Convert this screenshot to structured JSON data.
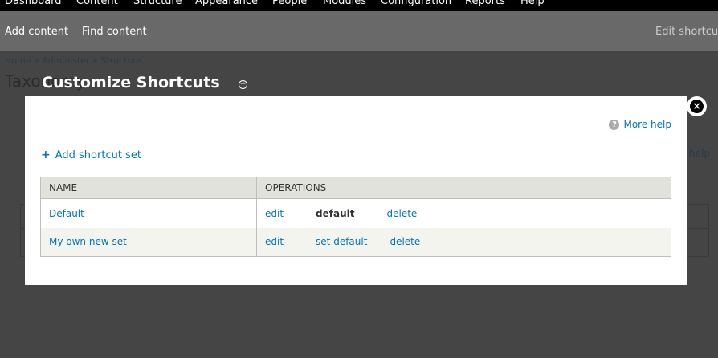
{
  "toolbar": {
    "items": [
      "Dashboard",
      "Content",
      "Structure",
      "Appearance",
      "People",
      "Modules",
      "Configuration",
      "Reports",
      "Help"
    ]
  },
  "shortcuts": {
    "items": [
      "Add content",
      "Find content"
    ],
    "edit": "Edit shortcuts"
  },
  "background": {
    "breadcrumb": "Home » Administer » Structure",
    "title": "Taxonomy",
    "help": "help"
  },
  "dialog": {
    "title": "Customize Shortcuts",
    "more_help": "More help",
    "add_set": "Add shortcut set",
    "columns": [
      "NAME",
      "OPERATIONS"
    ],
    "rows": [
      {
        "name": "Default",
        "edit": "edit",
        "status": "default",
        "delete": "delete"
      },
      {
        "name": "My own new set",
        "edit": "edit",
        "status": "set default",
        "delete": "delete"
      }
    ]
  }
}
